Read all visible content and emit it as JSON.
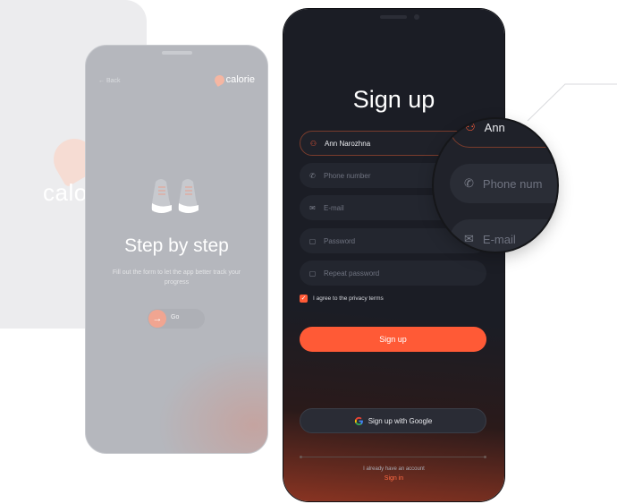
{
  "background_screen": {
    "brand_fragment": "calo"
  },
  "onboarding_screen": {
    "back_label": "← Back",
    "brand_name": "calorie",
    "title": "Step by step",
    "description": "Fill out the form to let the app better track your progress",
    "go_label": "Go",
    "go_icon": "arrow-right-icon"
  },
  "signup_screen": {
    "title": "Sign up",
    "fields": [
      {
        "name": "name-field",
        "icon": "person-icon",
        "glyph": "⚇",
        "value": "Ann Narozhna",
        "placeholder": "",
        "active": true
      },
      {
        "name": "phone-field",
        "icon": "phone-icon",
        "glyph": "✆",
        "value": "",
        "placeholder": "Phone number",
        "active": false
      },
      {
        "name": "email-field",
        "icon": "mail-icon",
        "glyph": "✉",
        "value": "",
        "placeholder": "E-mail",
        "active": false
      },
      {
        "name": "password-field",
        "icon": "lock-icon",
        "glyph": "🔒",
        "value": "",
        "placeholder": "Password",
        "active": false
      },
      {
        "name": "repeat-password-field",
        "icon": "lock-icon",
        "glyph": "🔒",
        "value": "",
        "placeholder": "Repeat password",
        "active": false
      }
    ],
    "agree_label": "I agree to the privacy terms",
    "agree_checked": true,
    "signup_button": "Sign up",
    "google_button": "Sign up with Google",
    "have_account_text": "I already have an account",
    "sign_in_link": "Sign in",
    "accent_color": "#ff5a36"
  },
  "zoom_lens": {
    "name_value": "Ann",
    "phone_placeholder": "Phone num",
    "email_placeholder": "E-mail"
  }
}
